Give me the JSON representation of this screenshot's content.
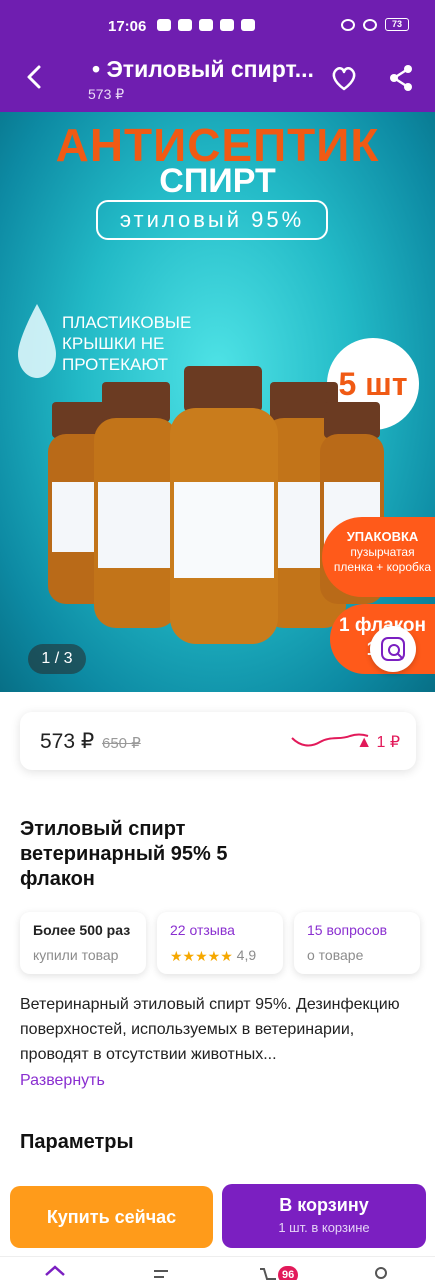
{
  "status": {
    "time": "17:06",
    "battery": "73"
  },
  "header": {
    "title": "• Этиловый спирт...",
    "price": "573 ₽"
  },
  "gallery": {
    "headline": "АНТИСЕПТИК",
    "subline": "СПИРТ",
    "pill": "этиловый 95%",
    "caps_note": "ПЛАСТИКОВЫЕ КРЫШКИ НЕ ПРОТЕКАЮТ",
    "count": "5 шт",
    "pack_title": "УПАКОВКА",
    "pack_text": "пузырчатая пленка + коробка",
    "flask": "1 флакон 100",
    "counter": "1 / 3"
  },
  "price_card": {
    "price": "573 ₽",
    "old_price": "650 ₽",
    "delta": "▲ 1 ₽"
  },
  "product_title": "Этиловый спирт ветеринарный 95% 5 флакон",
  "stats": [
    {
      "a": "Более 500 раз",
      "b": "купили товар"
    },
    {
      "a": "22 отзыва",
      "b": "4,9",
      "rating": 4.9
    },
    {
      "a": "15 вопросов",
      "b": "о товаре"
    }
  ],
  "description": "Ветеринарный этиловый спирт 95%. Дезинфекцию поверхностей, используемых в ветеринарии, проводят в отсутствии животных...",
  "expand": "Развернуть",
  "params_title": "Параметры",
  "actions": {
    "buy_now": "Купить сейчас",
    "to_cart": "В корзину",
    "cart_count_text": "1 шт. в корзине"
  },
  "tabbar": {
    "cart_badge": "96"
  },
  "colors": {
    "brand": "#6f1eb0",
    "accent": "#ff9b1a",
    "cart": "#7b1fc1",
    "alert": "#e21a5a"
  }
}
